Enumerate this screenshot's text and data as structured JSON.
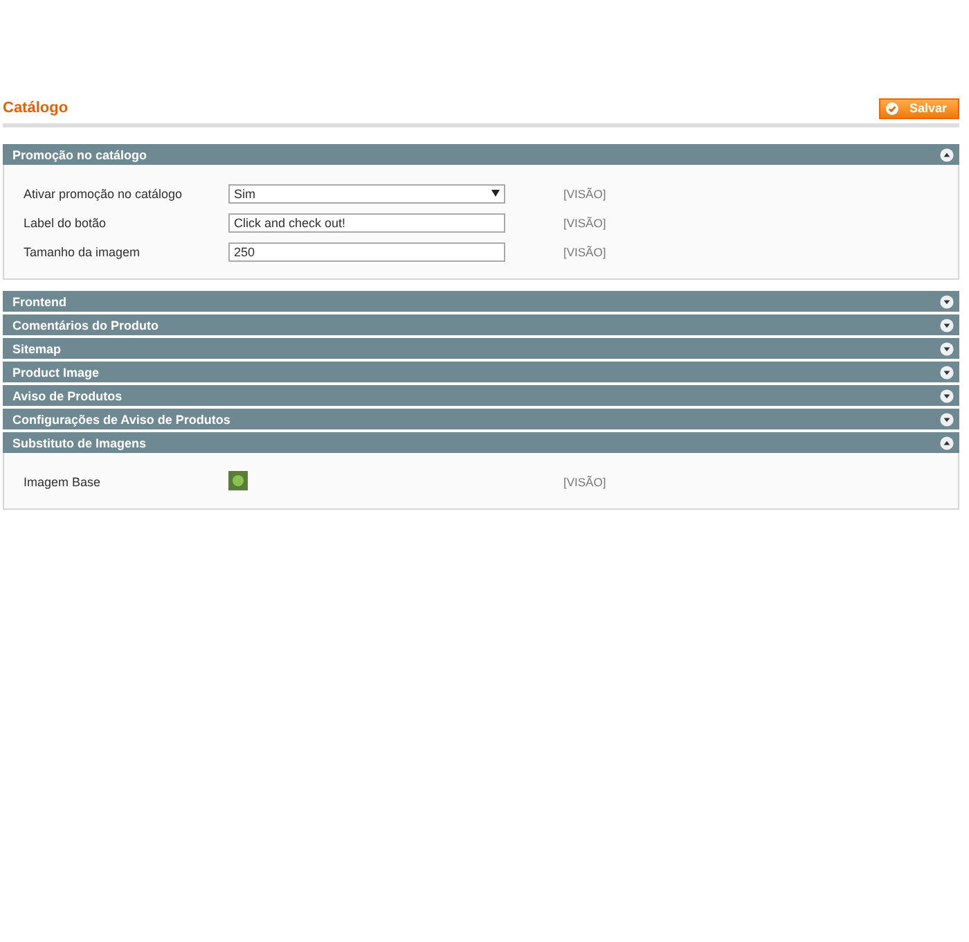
{
  "page": {
    "title": "Catálogo",
    "save_button": "Salvar"
  },
  "sections": [
    {
      "title": "Promoção no catálogo",
      "expanded": true,
      "fields": [
        {
          "kind": "select",
          "label": "Ativar promoção no catálogo",
          "value": "Sim",
          "scope": "[VISÃO]"
        },
        {
          "kind": "text",
          "label": "Label do botão",
          "value": "Click and check out!",
          "scope": "[VISÃO]"
        },
        {
          "kind": "text",
          "label": "Tamanho da imagem",
          "value": "250",
          "scope": "[VISÃO]"
        }
      ]
    },
    {
      "title": "Frontend",
      "expanded": false
    },
    {
      "title": "Comentários do Produto",
      "expanded": false
    },
    {
      "title": "Sitemap",
      "expanded": false
    },
    {
      "title": "Product Image",
      "expanded": false
    },
    {
      "title": "Aviso de Produtos",
      "expanded": false
    },
    {
      "title": "Configurações de Aviso de Produtos",
      "expanded": false
    },
    {
      "title": "Substituto de Imagens",
      "expanded": true,
      "fields": [
        {
          "kind": "image",
          "label": "Imagem Base",
          "scope": "[VISÃO]"
        }
      ]
    }
  ]
}
